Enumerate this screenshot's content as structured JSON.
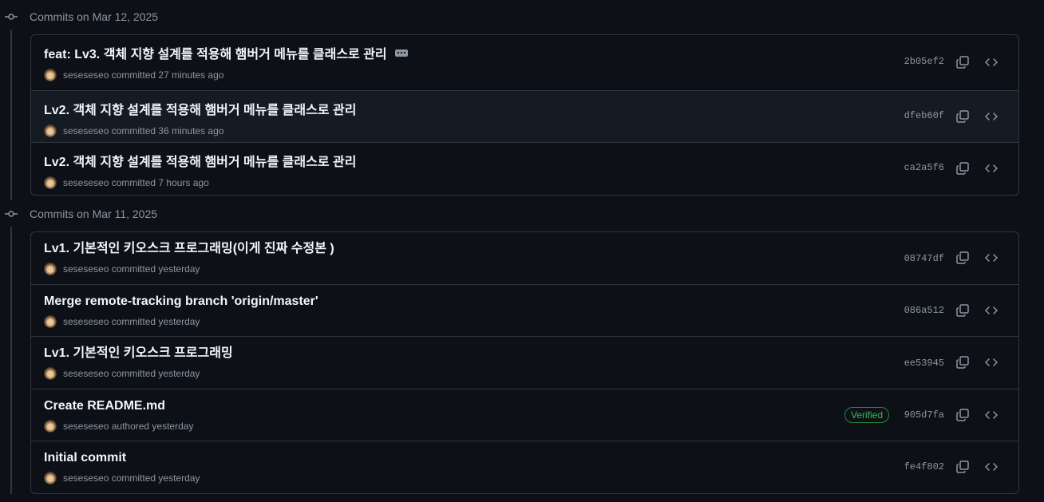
{
  "groups": [
    {
      "title": "Commits on Mar 12, 2025",
      "commits": [
        {
          "message": "feat: Lv3. 객체 지향 설계를 적용해 햄버거 메뉴를 클래스로 관리",
          "author": "seseseseo",
          "meta": "committed 27 minutes ago",
          "sha": "2b05ef2",
          "has_ellipsis": true
        },
        {
          "message": "Lv2. 객체 지향 설계를 적용해 햄버거 메뉴를 클래스로 관리",
          "author": "seseseseo",
          "meta": "committed 36 minutes ago",
          "sha": "dfeb60f"
        },
        {
          "message": "Lv2. 객체 지향 설계를 적용해 햄버거 메뉴를 클래스로 관리",
          "author": "seseseseo",
          "meta": "committed 7 hours ago",
          "sha": "ca2a5f6"
        }
      ]
    },
    {
      "title": "Commits on Mar 11, 2025",
      "commits": [
        {
          "message": "Lv1. 기본적인 키오스크 프로그래밍(이게 진짜 수정본 )",
          "author": "seseseseo",
          "meta": "committed yesterday",
          "sha": "08747df"
        },
        {
          "message": "Merge remote-tracking branch 'origin/master'",
          "author": "seseseseo",
          "meta": "committed yesterday",
          "sha": "086a512"
        },
        {
          "message": "Lv1. 기본적인 키오스크 프로그래밍",
          "author": "seseseseo",
          "meta": "committed yesterday",
          "sha": "ee53945"
        },
        {
          "message": "Create README.md",
          "author": "seseseseo",
          "meta": "authored yesterday",
          "sha": "905d7fa",
          "badge": "Verified"
        },
        {
          "message": "Initial commit",
          "author": "seseseseo",
          "meta": "committed yesterday",
          "sha": "fe4f802"
        }
      ]
    }
  ],
  "colors": {
    "background": "#0d1117",
    "border": "#30363d",
    "muted": "#8d96a0",
    "verified": "#3fb950"
  },
  "icons": {
    "group": "git-commit-icon",
    "copy": "copy-icon",
    "browse": "code-icon",
    "ellipsis": "kebab-horizontal-icon"
  }
}
